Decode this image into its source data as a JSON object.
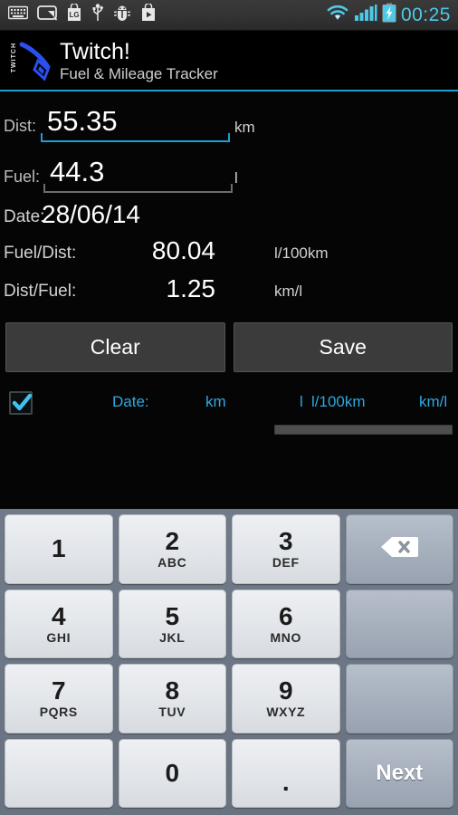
{
  "statusbar": {
    "left_icons": [
      "keyboard-icon",
      "screen-capture-icon",
      "lg-app-icon",
      "usb-icon",
      "android-debug-bug-icon",
      "play-store-icon"
    ],
    "right_icons": [
      "wifi-icon",
      "signal-bars-icon",
      "battery-charging-icon"
    ],
    "clock": "00:25"
  },
  "header": {
    "logo_word": "TWITCH",
    "title": "Twitch!",
    "subtitle": "Fuel & Mileage Tracker",
    "accent_color": "#1a9fd4"
  },
  "form": {
    "dist": {
      "label": "Dist:",
      "value": "55.35",
      "unit": "km",
      "focused": true
    },
    "fuel": {
      "label": "Fuel:",
      "value": "44.3",
      "unit": "l",
      "focused": false
    }
  },
  "stats": {
    "date": {
      "label": "Date:",
      "value": "28/06/14",
      "unit": ""
    },
    "fuel_per_dist": {
      "label": "Fuel/Dist:",
      "value": "80.04",
      "unit": "l/100km"
    },
    "dist_per_fuel": {
      "label": "Dist/Fuel:",
      "value": "1.25",
      "unit": "km/l"
    }
  },
  "actions": {
    "clear_label": "Clear",
    "save_label": "Save"
  },
  "list_header": {
    "select_all_checked": true,
    "columns": [
      "Date:",
      "km",
      "l",
      "l/100km",
      "km/l"
    ],
    "column_color": "#2fa8e0"
  },
  "keyboard": {
    "rows": [
      [
        {
          "digit": "1",
          "sub": "",
          "type": "digit"
        },
        {
          "digit": "2",
          "sub": "ABC",
          "type": "digit"
        },
        {
          "digit": "3",
          "sub": "DEF",
          "type": "digit"
        },
        {
          "digit": "",
          "sub": "",
          "type": "backspace",
          "icon": "backspace-icon"
        }
      ],
      [
        {
          "digit": "4",
          "sub": "GHI",
          "type": "digit"
        },
        {
          "digit": "5",
          "sub": "JKL",
          "type": "digit"
        },
        {
          "digit": "6",
          "sub": "MNO",
          "type": "digit"
        },
        {
          "digit": "",
          "sub": "",
          "type": "blank"
        }
      ],
      [
        {
          "digit": "7",
          "sub": "PQRS",
          "type": "digit"
        },
        {
          "digit": "8",
          "sub": "TUV",
          "type": "digit"
        },
        {
          "digit": "9",
          "sub": "WXYZ",
          "type": "digit"
        },
        {
          "digit": "",
          "sub": "",
          "type": "blank"
        }
      ],
      [
        {
          "digit": "",
          "sub": "",
          "type": "empty"
        },
        {
          "digit": "0",
          "sub": "",
          "type": "digit"
        },
        {
          "digit": ".",
          "sub": "",
          "type": "dot"
        },
        {
          "digit": "",
          "sub": "",
          "type": "action",
          "label": "Next"
        }
      ]
    ]
  }
}
